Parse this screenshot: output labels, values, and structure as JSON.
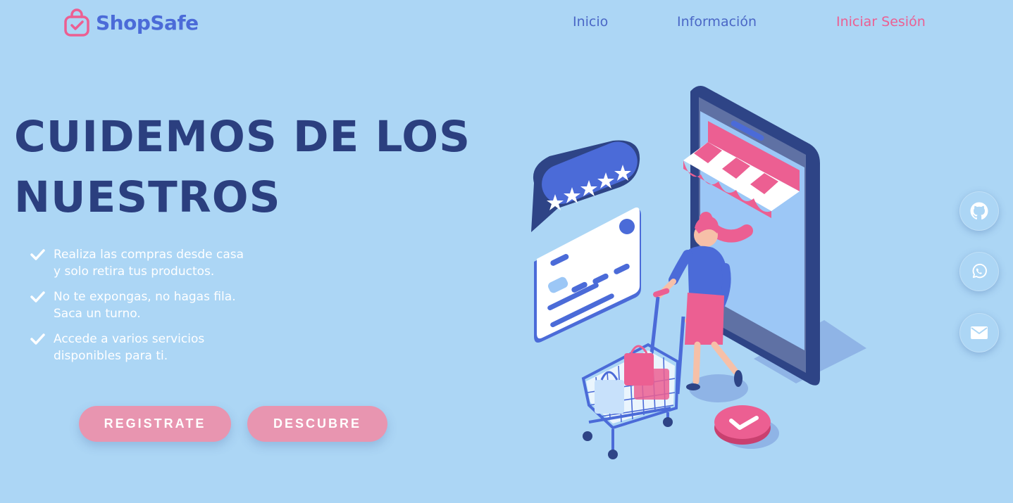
{
  "brand": {
    "name": "ShopSafe",
    "logo_icon": "shopping-bag-check-icon",
    "primary_color": "#4b6bd8",
    "accent_color": "#ec5f92"
  },
  "nav": {
    "home": "Inicio",
    "info": "Información",
    "login": "Iniciar Sesión"
  },
  "hero": {
    "title": "CUIDEMOS DE LOS NUESTROS",
    "features": [
      {
        "line1": "Realiza las compras desde casa",
        "line2": "y solo retira tus productos."
      },
      {
        "line1": "No te expongas, no hagas fila.",
        "line2": "Saca un turno."
      },
      {
        "line1": "Accede a varios servicios",
        "line2": "disponibles para ti."
      }
    ],
    "buttons": {
      "register": "REGISTRATE",
      "discover": "DESCUBRE"
    }
  },
  "social_icons": [
    "github-icon",
    "whatsapp-icon",
    "email-icon"
  ]
}
